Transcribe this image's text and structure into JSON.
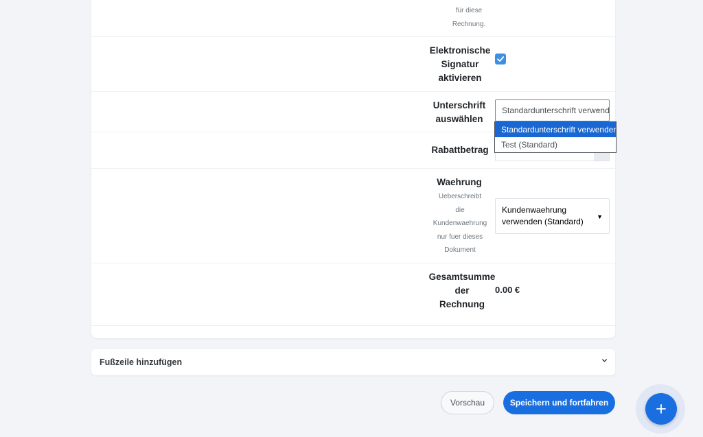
{
  "form": {
    "prev_hint_lines": [
      "für diese",
      "Rechnung."
    ],
    "esign": {
      "label_lines": [
        "Elektronische",
        "Signatur",
        "aktivieren"
      ],
      "checked": true
    },
    "signature": {
      "label_lines": [
        "Unterschrift",
        "auswählen"
      ],
      "selected": "Standardunterschrift verwenden",
      "options": [
        "Standardunterschrift verwenden",
        "Test (Standard)"
      ]
    },
    "discount": {
      "label": "Rabattbetrag",
      "value": ""
    },
    "currency": {
      "label": "Waehrung",
      "hint_lines": [
        "Ueberschreibt",
        "die",
        "Kundenwaehrung",
        "nur fuer dieses",
        "Dokument"
      ],
      "selected": "Kundenwaehrung verwenden (Standard)"
    },
    "total": {
      "label_lines": [
        "Gesamtsumme",
        "der",
        "Rechnung"
      ],
      "value": "0.00 €"
    }
  },
  "footer_section": {
    "title": "Fußzeile hinzufügen"
  },
  "actions": {
    "preview_label": "Vorschau",
    "save_label": "Speichern und fortfahren"
  },
  "colors": {
    "accent": "#1a6fe0",
    "background": "#f3f4f8",
    "checkbox": "#3d8fe4"
  },
  "icons": {
    "checkbox": "check-icon",
    "footer_toggle": "chevron-down-icon",
    "fab": "plus-icon"
  }
}
